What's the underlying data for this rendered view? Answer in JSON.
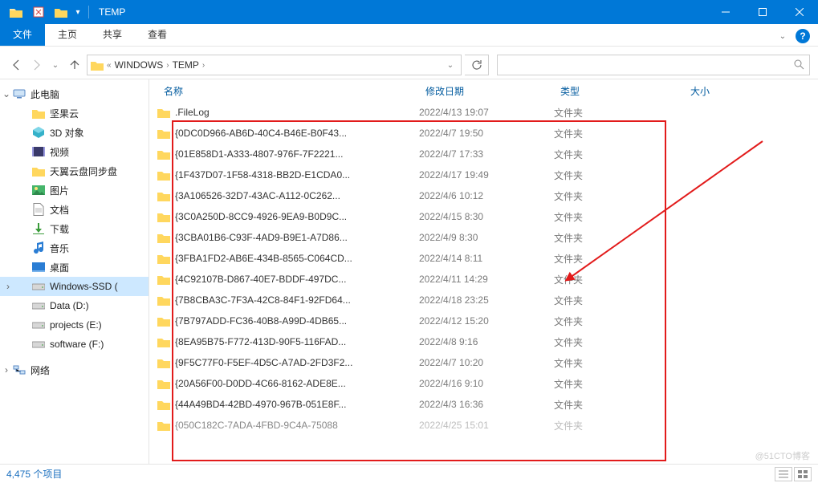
{
  "titlebar": {
    "title": "TEMP"
  },
  "ribbon": {
    "file": "文件",
    "tabs": {
      "home": "主页",
      "share": "共享",
      "view": "查看"
    }
  },
  "address": {
    "segments": [
      "WINDOWS",
      "TEMP"
    ]
  },
  "navpane": {
    "this_pc": "此电脑",
    "items": [
      {
        "label": "坚果云",
        "icon": "folder"
      },
      {
        "label": "3D 对象",
        "icon": "3d"
      },
      {
        "label": "视频",
        "icon": "video"
      },
      {
        "label": "天翼云盘同步盘",
        "icon": "folder"
      },
      {
        "label": "图片",
        "icon": "picture"
      },
      {
        "label": "文档",
        "icon": "document"
      },
      {
        "label": "下载",
        "icon": "download"
      },
      {
        "label": "音乐",
        "icon": "music"
      },
      {
        "label": "桌面",
        "icon": "desktop"
      },
      {
        "label": "Windows-SSD (",
        "icon": "drive",
        "selected": true
      },
      {
        "label": "Data (D:)",
        "icon": "drive"
      },
      {
        "label": "projects (E:)",
        "icon": "drive"
      },
      {
        "label": "software (F:)",
        "icon": "drive"
      }
    ],
    "network": "网络"
  },
  "columns": {
    "name": "名称",
    "date": "修改日期",
    "type": "类型",
    "size": "大小"
  },
  "type_folder": "文件夹",
  "files": [
    {
      "name": ".FileLog",
      "date": "2022/4/13 19:07"
    },
    {
      "name": "{0DC0D966-AB6D-40C4-B46E-B0F43...",
      "date": "2022/4/7 19:50"
    },
    {
      "name": "{01E858D1-A333-4807-976F-7F2221...",
      "date": "2022/4/7 17:33"
    },
    {
      "name": "{1F437D07-1F58-4318-BB2D-E1CDA0...",
      "date": "2022/4/17 19:49"
    },
    {
      "name": "{3A106526-32D7-43AC-A112-0C262...",
      "date": "2022/4/6 10:12"
    },
    {
      "name": "{3C0A250D-8CC9-4926-9EA9-B0D9C...",
      "date": "2022/4/15 8:30"
    },
    {
      "name": "{3CBA01B6-C93F-4AD9-B9E1-A7D86...",
      "date": "2022/4/9 8:30"
    },
    {
      "name": "{3FBA1FD2-AB6E-434B-8565-C064CD...",
      "date": "2022/4/14 8:11"
    },
    {
      "name": "{4C92107B-D867-40E7-BDDF-497DC...",
      "date": "2022/4/11 14:29"
    },
    {
      "name": "{7B8CBA3C-7F3A-42C8-84F1-92FD64...",
      "date": "2022/4/18 23:25"
    },
    {
      "name": "{7B797ADD-FC36-40B8-A99D-4DB65...",
      "date": "2022/4/12 15:20"
    },
    {
      "name": "{8EA95B75-F772-413D-90F5-116FAD...",
      "date": "2022/4/8 9:16"
    },
    {
      "name": "{9F5C77F0-F5EF-4D5C-A7AD-2FD3F2...",
      "date": "2022/4/7 10:20"
    },
    {
      "name": "{20A56F00-D0DD-4C66-8162-ADE8E...",
      "date": "2022/4/16 9:10"
    },
    {
      "name": "{44A49BD4-42BD-4970-967B-051E8F...",
      "date": "2022/4/3 16:36"
    },
    {
      "name": "{050C182C-7ADA-4FBD-9C4A-75088",
      "date": "2022/4/25 15:01",
      "cut": true
    }
  ],
  "status": {
    "count_text": "4,475 个项目"
  },
  "watermark": "@51CTO博客"
}
